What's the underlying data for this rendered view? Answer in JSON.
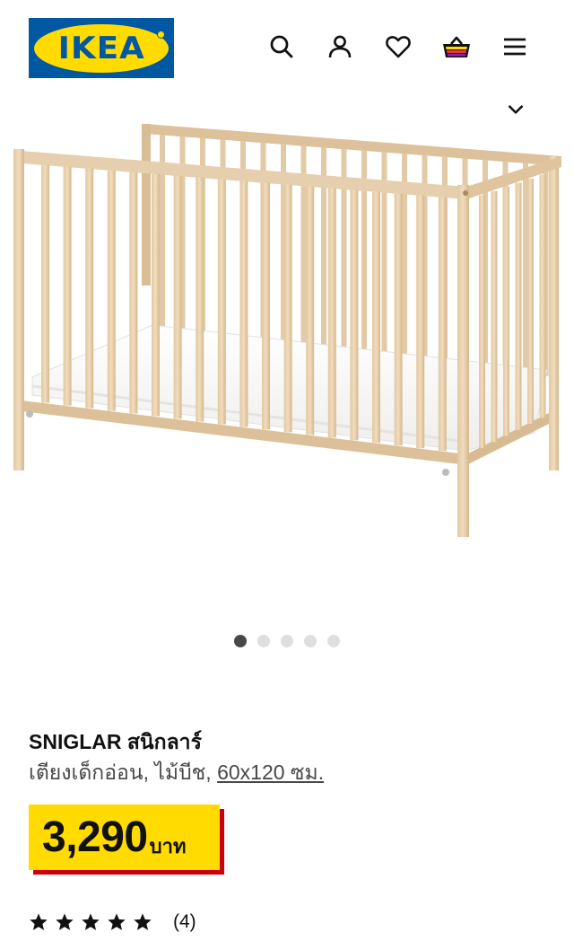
{
  "header": {
    "logo": {
      "text": "IKEA",
      "bg_color": "#0058a3",
      "oval_color": "#ffdb00"
    },
    "icons": [
      "search-icon",
      "account-icon",
      "heart-icon",
      "basket-icon",
      "menu-icon"
    ]
  },
  "gallery": {
    "image": "baby-crib-photo",
    "dot_count": 5,
    "active_dot": 0
  },
  "product": {
    "name": "SNIGLAR สนิกลาร์",
    "description_prefix": "เตียงเด็กอ่อน, ไม้บีช, ",
    "size_link": "60x120 ซม."
  },
  "price": {
    "amount": "3,290",
    "currency": "บาท",
    "box_color": "#ffdb00",
    "shadow_color": "#cc0008"
  },
  "rating": {
    "stars": 5,
    "count_label": "(4)"
  }
}
